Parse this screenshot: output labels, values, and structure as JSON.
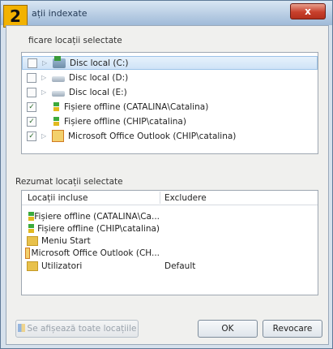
{
  "window": {
    "step_number": "2",
    "title": "ații indexate",
    "close_label": "x"
  },
  "modify": {
    "label": "ficare locații selectate",
    "items": [
      {
        "label": "Disc local (C:)",
        "checked": false,
        "icon": "drive-c-icon"
      },
      {
        "label": "Disc local (D:)",
        "checked": false,
        "icon": "drive-icon"
      },
      {
        "label": "Disc local (E:)",
        "checked": false,
        "icon": "drive-icon"
      },
      {
        "label": "Fișiere offline (CATALINA\\Catalina)",
        "checked": true,
        "icon": "offline-files-icon"
      },
      {
        "label": "Fișiere offline (CHIP\\catalina)",
        "checked": true,
        "icon": "offline-files-icon"
      },
      {
        "label": "Microsoft Office Outlook (CHIP\\catalina)",
        "checked": true,
        "icon": "outlook-icon"
      }
    ]
  },
  "summary": {
    "label": "Rezumat locații selectate",
    "col_included": "Locații incluse",
    "col_excluded": "Excludere",
    "rows": [
      {
        "included": "Fișiere offline (CATALINA\\Ca...",
        "excluded": "",
        "icon": "offline-files-icon"
      },
      {
        "included": "Fișiere offline (CHIP\\catalina)",
        "excluded": "",
        "icon": "offline-files-icon"
      },
      {
        "included": "Meniu Start",
        "excluded": "",
        "icon": "folder-icon"
      },
      {
        "included": "Microsoft Office Outlook (CH...",
        "excluded": "",
        "icon": "outlook-icon"
      },
      {
        "included": "Utilizatori",
        "excluded": "Default",
        "icon": "folder-icon"
      }
    ]
  },
  "buttons": {
    "show_all": "Se afișează toate locațiile",
    "ok": "OK",
    "cancel": "Revocare"
  }
}
